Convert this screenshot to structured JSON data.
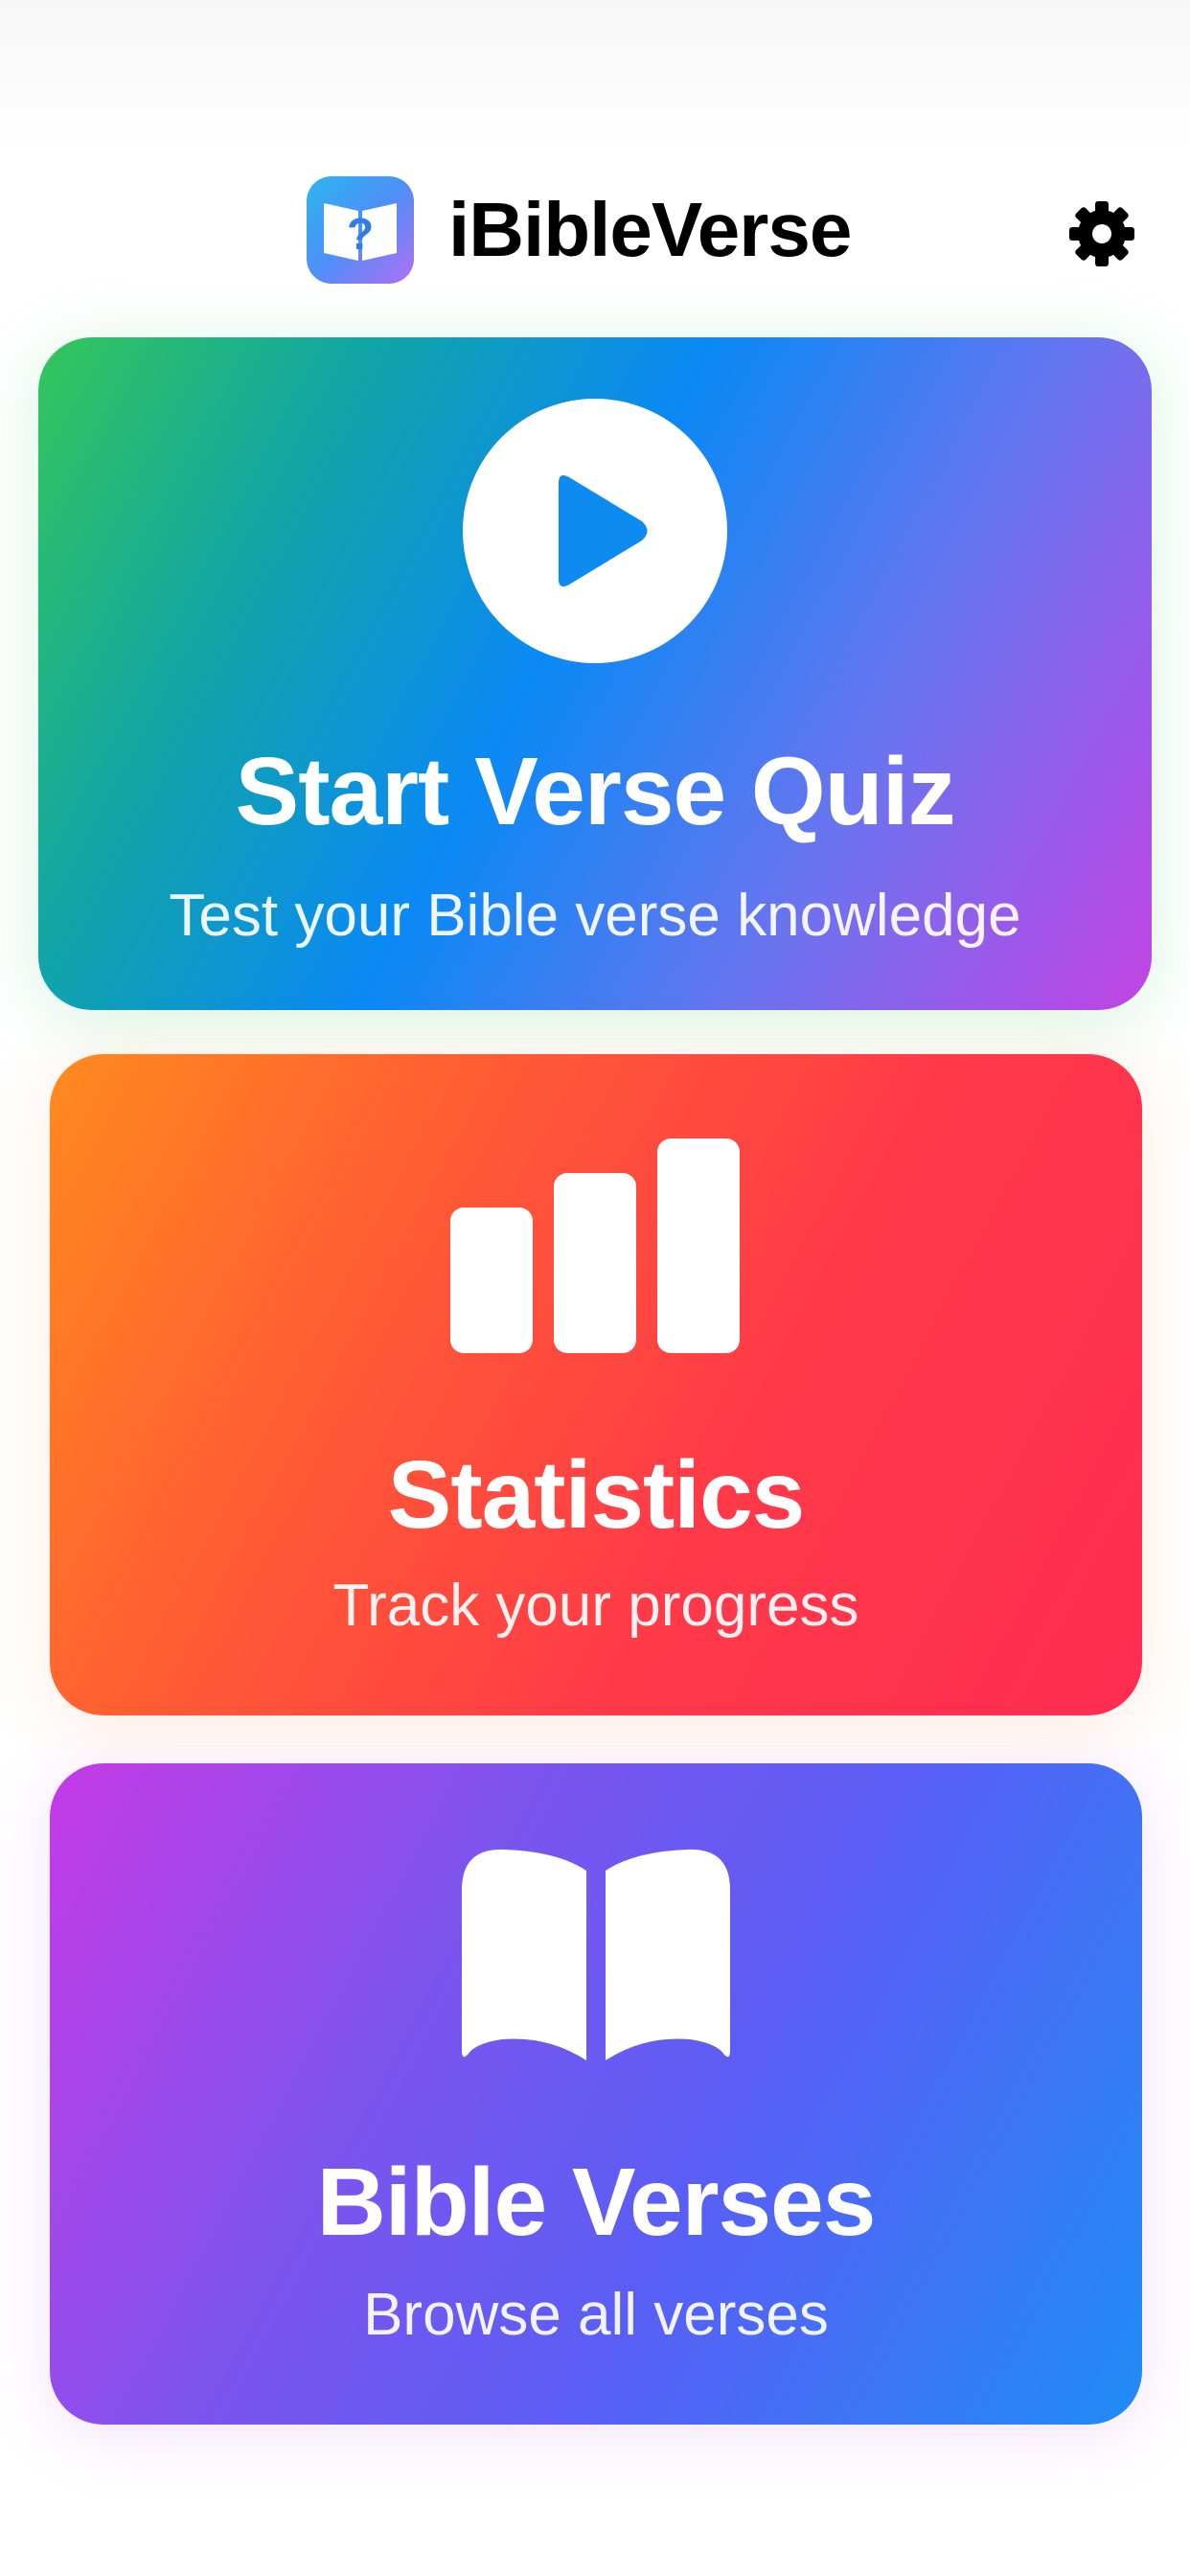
{
  "app": {
    "title": "iBibleVerse",
    "logo_icon": "question-book-icon",
    "settings_icon": "gear-icon"
  },
  "cards": [
    {
      "id": "quiz",
      "title": "Start Verse Quiz",
      "subtitle": "Test your Bible verse knowledge",
      "icon": "play-circle-icon"
    },
    {
      "id": "statistics",
      "title": "Statistics",
      "subtitle": "Track your progress",
      "icon": "bar-chart-icon"
    },
    {
      "id": "verses",
      "title": "Bible Verses",
      "subtitle": "Browse all verses",
      "icon": "open-book-icon"
    }
  ],
  "colors": {
    "quiz_gradient": [
      "#35c659",
      "#0a89f5",
      "#c343e4"
    ],
    "statistics_gradient": [
      "#ff8a1e",
      "#ff3a48",
      "#ff2c52"
    ],
    "verses_gradient": [
      "#c53be6",
      "#5a5ef5",
      "#1f8cf7"
    ],
    "text": "#000000"
  }
}
